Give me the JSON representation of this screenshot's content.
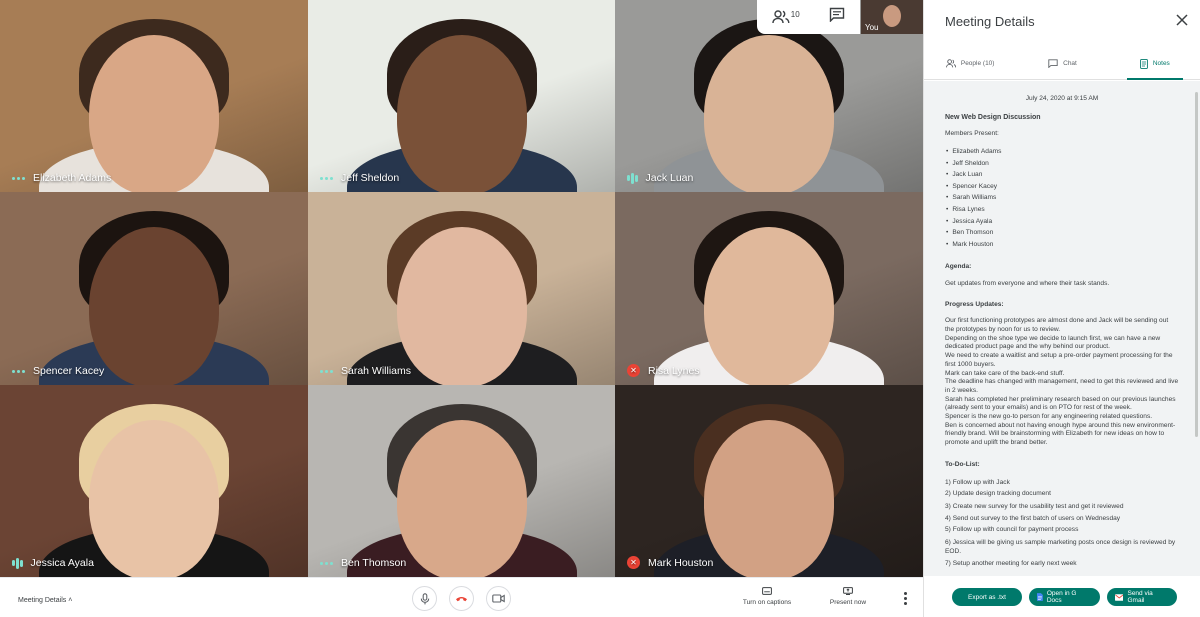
{
  "top_controls": {
    "people_count": "10",
    "self_label": "You"
  },
  "participants": [
    {
      "name": "Elizabeth Adams",
      "status": "speaking-dots",
      "bg": "#a77d55",
      "skin": "#d9a786",
      "hair": "#3d2a1e",
      "shirt": "#e7e2dc"
    },
    {
      "name": "Jeff Sheldon",
      "status": "speaking-dots",
      "bg": "#e9ece6",
      "skin": "#7a5138",
      "hair": "#2a1e18",
      "shirt": "#27364d"
    },
    {
      "name": "Jack Luan",
      "status": "speaking-bars",
      "bg": "#9a9a98",
      "skin": "#d9b396",
      "hair": "#1b1614",
      "shirt": "#8f9396"
    },
    {
      "name": "Spencer Kacey",
      "status": "speaking-dots",
      "bg": "#8b6b55",
      "skin": "#6a4330",
      "hair": "#1c1410",
      "shirt": "#2b3a55"
    },
    {
      "name": "Sarah Williams",
      "status": "speaking-dots",
      "bg": "#c9b298",
      "skin": "#e1b8a0",
      "hair": "#5b3b26",
      "shirt": "#1e1e20"
    },
    {
      "name": "Risa Lynes",
      "status": "muted",
      "bg": "#7b6a60",
      "skin": "#e0b89b",
      "hair": "#1e1612",
      "shirt": "#f0eeee"
    },
    {
      "name": "Jessica Ayala",
      "status": "speaking-bars",
      "bg": "#6b4434",
      "skin": "#e8c3a6",
      "hair": "#e8cfa0",
      "shirt": "#151515"
    },
    {
      "name": "Ben Thomson",
      "status": "speaking-dots",
      "bg": "#b8b6b2",
      "skin": "#d8a88a",
      "hair": "#3a3532",
      "shirt": "#3a1d22"
    },
    {
      "name": "Mark Houston",
      "status": "muted",
      "bg": "#2d2521",
      "skin": "#d2a184",
      "hair": "#4a2f20",
      "shirt": "#1d1f27"
    }
  ],
  "bottom_bar": {
    "meeting_details": "Meeting Details ˄",
    "captions": "Turn on captions",
    "present": "Present now"
  },
  "panel": {
    "title": "Meeting Details",
    "tabs": [
      {
        "label": "People (10)",
        "icon": "people-icon",
        "active": false
      },
      {
        "label": "Chat",
        "icon": "chat-icon",
        "active": false
      },
      {
        "label": "Notes",
        "icon": "notes-icon",
        "active": true
      }
    ],
    "notes": {
      "date": "July 24, 2020 at 9:15 AM",
      "title": "New Web Design Discussion",
      "members_label": "Members Present:",
      "members": [
        "Elizabeth Adams",
        "Jeff Sheldon",
        "Jack Luan",
        "Spencer Kacey",
        "Sarah Williams",
        "Risa Lynes",
        "Jessica Ayala",
        "Ben Thomson",
        "Mark Houston"
      ],
      "agenda_label": "Agenda:",
      "agenda": "Get updates from everyone and where their task stands.",
      "progress_label": "Progress Updates:",
      "progress": [
        "Our first functioning prototypes are almost done and Jack will be sending out the prototypes by noon for us to review.",
        "Depending on the shoe type we decide to launch first, we can have a new dedicated product page and the why behind our product.",
        "We need to create a waitlist and setup a pre-order payment processing for the first 1000 buyers.",
        "Mark can take care of the back-end stuff.",
        "The deadline has changed with management, need to get this reviewed and live in 2 weeks.",
        "Sarah has completed her preliminary research based on our previous launches (already sent to your emails) and is on PTO for rest of the week.",
        "Spencer is the new go-to person for any engineering related questions.",
        "Ben is concerned about not having enough hype around this new environment-friendly brand. Will be brainstorming with Elizabeth for new ideas on how to promote and uplift the brand better."
      ],
      "todo_label": "To-Do-List:",
      "todo": [
        "1) Follow up with Jack",
        "2) Update design tracking document",
        "3) Create new survey for the usability test and get it reviewed",
        "4) Send out survey to the first batch of users on Wednesday",
        "5) Follow up with council for payment process",
        "6) Jessica will be giving us sample marketing posts once design is reviewed by EOD.",
        "7) Setup another meeting for early next week"
      ]
    },
    "buttons": {
      "export": "Export as .txt",
      "docs": "Open in G Docs",
      "gmail": "Send via Gmail"
    }
  },
  "colors": {
    "accent": "#00796b",
    "notes_bg": "#f1f3f4",
    "speaking": "#7ee0d0",
    "muted": "#ea4335"
  }
}
